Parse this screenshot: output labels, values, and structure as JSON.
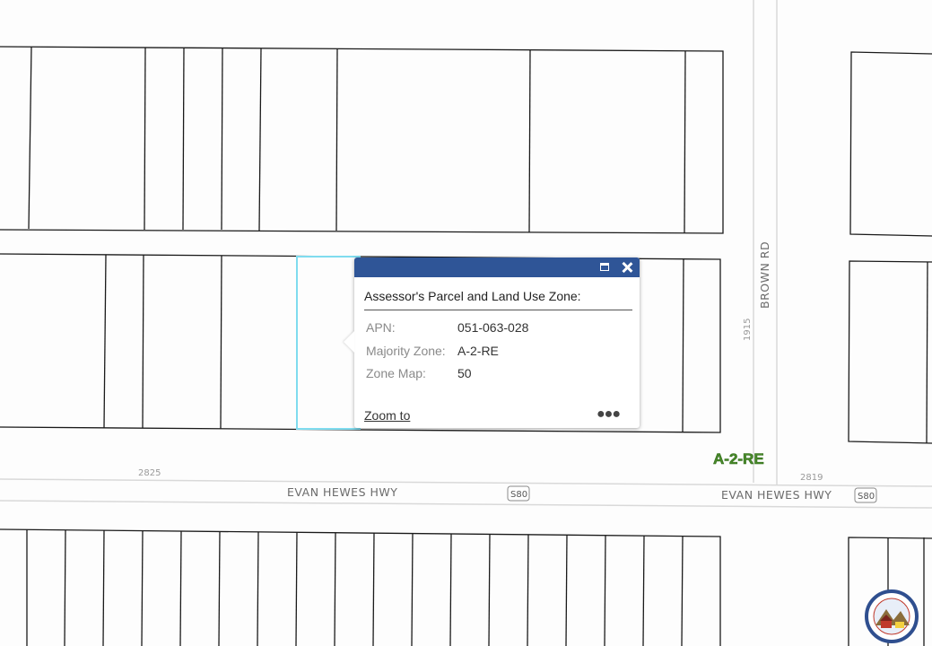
{
  "map": {
    "roads": {
      "evan_hewes_west": "EVAN HEWES HWY",
      "evan_hewes_east": "EVAN HEWES HWY",
      "brown_rd": "BROWN RD"
    },
    "route_shields": [
      "S80",
      "S80"
    ],
    "address_labels": [
      "2825",
      "2819",
      "1915"
    ],
    "zone_label": "A-2-RE",
    "colors": {
      "popup_header": "#2f5597",
      "selection_outline": "#7fdcef",
      "zone_label": "#4a8a2a"
    }
  },
  "popup": {
    "title": "Assessor's Parcel and Land Use Zone:",
    "attributes": [
      {
        "key": "APN:",
        "value": "051-063-028"
      },
      {
        "key": "Majority Zone:",
        "value": "A-2-RE"
      },
      {
        "key": "Zone Map:",
        "value": "50"
      }
    ],
    "zoom_link": "Zoom to",
    "more_icon": "ellipsis-icon",
    "maximize_icon": "maximize-icon",
    "close_icon": "close-icon"
  },
  "logo": {
    "icon": "county-association-logo"
  }
}
